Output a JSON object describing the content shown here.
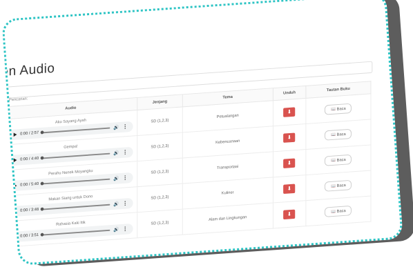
{
  "page_title": "en Audio",
  "search": {
    "label": "Pencarian:"
  },
  "table": {
    "headers": [
      "Audio",
      "Jenjang",
      "Tema",
      "Unduh",
      "Tautan Buku"
    ],
    "rows": [
      {
        "title": "Aku Sayang Ayah",
        "time": "0:00 / 2:57",
        "jenjang": "SD (1,2,3)",
        "tema": "Petualangan",
        "read": "Baca"
      },
      {
        "title": "Gempa!",
        "time": "0:00 / 4:40",
        "jenjang": "SD (1,2,3)",
        "tema": "Kebencanaan",
        "read": "Baca"
      },
      {
        "title": "Perahu Nenek Moyangku",
        "time": "0:00 / 5:40",
        "jenjang": "SD (1,2,3)",
        "tema": "Transportasi",
        "read": "Baca"
      },
      {
        "title": "Makan Siang untuk Dono",
        "time": "0:00 / 3:48",
        "jenjang": "SD (1,2,3)",
        "tema": "Kuliner",
        "read": "Baca"
      },
      {
        "title": "Rahasia Kaki Itik",
        "time": "0:00 / 3:51",
        "jenjang": "SD (1,2,3)",
        "tema": "Alam dan Lingkungan",
        "read": "Baca"
      }
    ]
  },
  "colors": {
    "frame_dots": "#2ec4c4",
    "download": "#d9534f",
    "shadow": "#5d5d5d"
  },
  "icons": {
    "play": "play-icon",
    "volume": "volume-icon",
    "more": "kebab-icon",
    "download": "download-icon",
    "book": "book-icon"
  }
}
